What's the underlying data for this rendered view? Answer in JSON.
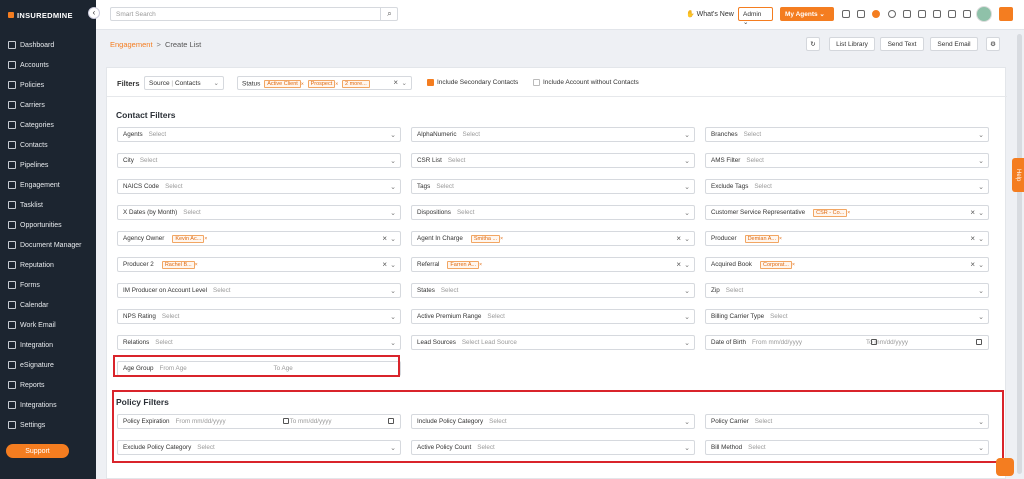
{
  "brand": {
    "name": "INSUREDMINE",
    "accent": "#f47d20",
    "sidebar_bg": "#1c2530",
    "alert_red": "#d9242b"
  },
  "sidebar": {
    "items": [
      {
        "label": "Dashboard",
        "icon": "dashboard-icon"
      },
      {
        "label": "Accounts",
        "icon": "accounts-icon"
      },
      {
        "label": "Policies",
        "icon": "policies-icon"
      },
      {
        "label": "Carriers",
        "icon": "carriers-icon"
      },
      {
        "label": "Categories",
        "icon": "categories-icon"
      },
      {
        "label": "Contacts",
        "icon": "contacts-icon"
      },
      {
        "label": "Pipelines",
        "icon": "pipelines-icon"
      },
      {
        "label": "Engagement",
        "icon": "engagement-icon"
      },
      {
        "label": "Tasklist",
        "icon": "tasklist-icon"
      },
      {
        "label": "Opportunities",
        "icon": "opportunities-icon"
      },
      {
        "label": "Document Manager",
        "icon": "document-icon"
      },
      {
        "label": "Reputation",
        "icon": "reputation-icon"
      },
      {
        "label": "Forms",
        "icon": "forms-icon"
      },
      {
        "label": "Calendar",
        "icon": "calendar-icon"
      },
      {
        "label": "Work Email",
        "icon": "email-icon"
      },
      {
        "label": "Integration",
        "icon": "integration-icon"
      },
      {
        "label": "eSignature",
        "icon": "esignature-icon"
      },
      {
        "label": "Reports",
        "icon": "reports-icon"
      },
      {
        "label": "Integrations",
        "icon": "integrations-icon"
      },
      {
        "label": "Settings",
        "icon": "settings-icon"
      }
    ],
    "support": "Support"
  },
  "topbar": {
    "search_placeholder": "Smart Search",
    "whats_new": "What's New",
    "admin": "Admin",
    "my_agents": "My Agents"
  },
  "header": {
    "crumb_parent": "Engagement",
    "crumb_separator": ">",
    "crumb_current": "Create List",
    "buttons": {
      "list_library": "List Library",
      "send_text": "Send Text",
      "send_email": "Send Email"
    }
  },
  "filterbar": {
    "title": "Filters",
    "source_label": "Source",
    "source_value": "Contacts",
    "status_label": "Status",
    "status_chips": [
      "Active Client",
      "Prospect",
      "2 more..."
    ],
    "include_secondary": "Include Secondary Contacts",
    "include_without": "Include Account without Contacts"
  },
  "contact_filters": {
    "title": "Contact Filters",
    "fields": [
      {
        "label": "Agents",
        "value": "Select"
      },
      {
        "label": "AlphaNumeric",
        "value": "Select"
      },
      {
        "label": "Branches",
        "value": "Select"
      },
      {
        "label": "City",
        "value": "Select"
      },
      {
        "label": "CSR List",
        "value": "Select"
      },
      {
        "label": "AMS Filter",
        "value": "Select"
      },
      {
        "label": "NAICS Code",
        "value": "Select"
      },
      {
        "label": "Tags",
        "value": "Select"
      },
      {
        "label": "Exclude Tags",
        "value": "Select"
      },
      {
        "label": "X Dates (by Month)",
        "value": "Select"
      },
      {
        "label": "Dispositions",
        "value": "Select"
      },
      {
        "label": "Customer Service Representative",
        "chip": "CSR - Co..."
      },
      {
        "label": "Agency Owner",
        "chip": "Kevin Ac..."
      },
      {
        "label": "Agent In Charge",
        "chip": "Smitha ..."
      },
      {
        "label": "Producer",
        "chip": "Demian A..."
      },
      {
        "label": "Producer 2",
        "chip": "Rachel B..."
      },
      {
        "label": "Referral",
        "chip": "Farren A..."
      },
      {
        "label": "Acquired Book",
        "chip": "Corporat..."
      },
      {
        "label": "IM Producer on Account Level",
        "value": "Select"
      },
      {
        "label": "States",
        "value": "Select"
      },
      {
        "label": "Zip",
        "value": "Select"
      },
      {
        "label": "NPS Rating",
        "value": "Select"
      },
      {
        "label": "Active Premium Range",
        "value": "Select"
      },
      {
        "label": "Billing Carrier Type",
        "value": "Select"
      },
      {
        "label": "Relations",
        "value": "Select"
      },
      {
        "label": "Lead Sources",
        "value": "Select Lead Source"
      },
      {
        "label": "Date of Birth",
        "from": "From mm/dd/yyyy",
        "to": "To mm/dd/yyyy"
      },
      {
        "label": "Age Group",
        "from": "From Age",
        "to": "To Age"
      }
    ]
  },
  "policy_filters": {
    "title": "Policy Filters",
    "fields": [
      {
        "label": "Policy Expiration",
        "from": "From mm/dd/yyyy",
        "to": "To mm/dd/yyyy"
      },
      {
        "label": "Include Policy Category",
        "value": "Select"
      },
      {
        "label": "Policy Carrier",
        "value": "Select"
      },
      {
        "label": "Exclude Policy Category",
        "value": "Select"
      },
      {
        "label": "Active Policy Count",
        "value": "Select"
      },
      {
        "label": "Bill Method",
        "value": "Select"
      }
    ]
  },
  "help_tab": "Help"
}
